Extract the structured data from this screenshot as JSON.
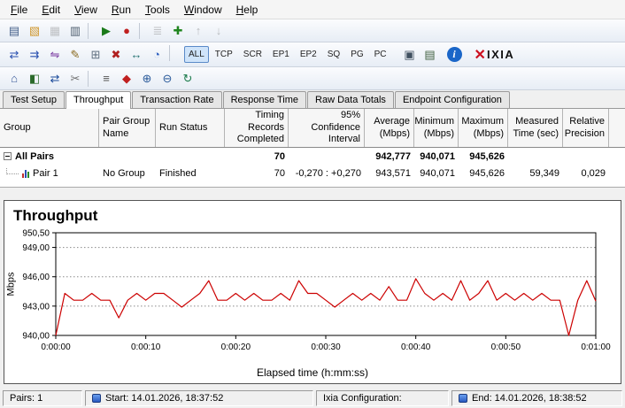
{
  "menu": {
    "items": [
      {
        "label": "File"
      },
      {
        "label": "Edit"
      },
      {
        "label": "View"
      },
      {
        "label": "Run"
      },
      {
        "label": "Tools"
      },
      {
        "label": "Window"
      },
      {
        "label": "Help"
      }
    ]
  },
  "toolbar_row1": {
    "icons": [
      {
        "name": "new-test-icon",
        "glyph": "▤",
        "color": "#44608a"
      },
      {
        "name": "open-test-icon",
        "glyph": "▧",
        "color": "#d09830"
      },
      {
        "name": "save-test-icon",
        "glyph": "▦",
        "color": "#607090",
        "disabled": true
      },
      {
        "name": "print-icon",
        "glyph": "▥",
        "color": "#506070"
      },
      {
        "sep": true
      },
      {
        "name": "run-test-icon",
        "glyph": "▶",
        "color": "#1a7a1a"
      },
      {
        "name": "abort-test-icon",
        "glyph": "●",
        "color": "#c02020"
      },
      {
        "sep": true
      },
      {
        "name": "view-results-icon",
        "glyph": "≣",
        "color": "#707070",
        "disabled": true
      },
      {
        "name": "add-item-icon",
        "glyph": "✚",
        "color": "#20851f"
      },
      {
        "name": "move-up-icon",
        "glyph": "↑",
        "color": "#606060",
        "disabled": true
      },
      {
        "name": "move-down-icon",
        "glyph": "↓",
        "color": "#606060",
        "disabled": true
      }
    ]
  },
  "toolbar_row2": {
    "icons_left": [
      {
        "name": "add-endpoint-pair-icon",
        "glyph": "⇄",
        "color": "#2a50b0"
      },
      {
        "name": "add-multicast-group-icon",
        "glyph": "⇉",
        "color": "#2a50b0"
      },
      {
        "name": "add-vpn-pair-icon",
        "glyph": "⇋",
        "color": "#7a3aa0"
      },
      {
        "name": "edit-pair-icon",
        "glyph": "✎",
        "color": "#8a6a20"
      },
      {
        "name": "copy-pair-icon",
        "glyph": "⊞",
        "color": "#607080"
      },
      {
        "name": "delete-pair-icon",
        "glyph": "✖",
        "color": "#b02020"
      },
      {
        "name": "connect-endpoints-icon",
        "glyph": "↔",
        "color": "#207070"
      },
      {
        "name": "schedule-icon",
        "glyph": "◔",
        "color": "#3060c0"
      },
      {
        "sep": true
      }
    ],
    "view_buttons": [
      {
        "name": "view-all-button",
        "label": "ALL",
        "active": true
      },
      {
        "name": "view-tcp-button",
        "label": "TCP"
      },
      {
        "name": "view-scr-button",
        "label": "SCR"
      },
      {
        "name": "view-ep1-button",
        "label": "EP1"
      },
      {
        "name": "view-ep2-button",
        "label": "EP2"
      },
      {
        "name": "view-sq-button",
        "label": "SQ"
      },
      {
        "name": "view-pg-button",
        "label": "PG"
      },
      {
        "name": "view-pc-button",
        "label": "PC"
      }
    ],
    "icons_right": [
      {
        "name": "snapshot-icon",
        "glyph": "▣",
        "color": "#405060"
      },
      {
        "name": "report-icon",
        "glyph": "▤",
        "color": "#406040"
      }
    ],
    "info_label": "i",
    "logo_mark": "✕",
    "logo_text": "IXIA"
  },
  "toolbar_row3": {
    "icons": [
      {
        "name": "add-console-icon",
        "glyph": "⌂",
        "color": "#3a5a9a"
      },
      {
        "name": "add-endpoint-icon",
        "glyph": "◧",
        "color": "#2a6a2a"
      },
      {
        "name": "link-endpoints-icon",
        "glyph": "⇄",
        "color": "#1a4a9a"
      },
      {
        "name": "cut-pair-icon",
        "glyph": "✂",
        "color": "#707070"
      },
      {
        "sep": true
      },
      {
        "name": "pair-properties-icon",
        "glyph": "≡",
        "color": "#555555"
      },
      {
        "name": "color-legend-icon",
        "glyph": "◆",
        "color": "#c02020"
      },
      {
        "name": "zoom-in-icon",
        "glyph": "⊕",
        "color": "#2a5a9a"
      },
      {
        "name": "zoom-out-icon",
        "glyph": "⊖",
        "color": "#2a5a9a"
      },
      {
        "name": "refresh-icon",
        "glyph": "↻",
        "color": "#1a7a4a"
      }
    ]
  },
  "tabs": [
    {
      "label": "Test Setup"
    },
    {
      "label": "Throughput",
      "active": true
    },
    {
      "label": "Transaction Rate"
    },
    {
      "label": "Response Time"
    },
    {
      "label": "Raw Data Totals"
    },
    {
      "label": "Endpoint Configuration"
    }
  ],
  "results_table": {
    "headers": [
      {
        "label": "Group"
      },
      {
        "label": "Pair Group\nName"
      },
      {
        "label": "Run Status"
      },
      {
        "label": "Timing Records\nCompleted",
        "cls": "right"
      },
      {
        "label": "95% Confidence\nInterval",
        "cls": "right"
      },
      {
        "label": "Average\n(Mbps)",
        "cls": "right"
      },
      {
        "label": "Minimum\n(Mbps)",
        "cls": "right"
      },
      {
        "label": "Maximum\n(Mbps)",
        "cls": "right"
      },
      {
        "label": "Measured\nTime (sec)",
        "cls": "right"
      },
      {
        "label": "Relative\nPrecision",
        "cls": "right"
      }
    ],
    "rows": {
      "all_pairs": {
        "group": "All Pairs",
        "timing_records": "70",
        "average": "942,777",
        "minimum": "940,071",
        "maximum": "945,626"
      },
      "pair1": {
        "group": "Pair 1",
        "pair_group": "No Group",
        "run_status": "Finished",
        "timing_records": "70",
        "confidence_interval": "-0,270 : +0,270",
        "average": "943,571",
        "minimum": "940,071",
        "maximum": "945,626",
        "measured_time": "59,349",
        "relative_precision": "0,029"
      }
    }
  },
  "chart_data": {
    "type": "line",
    "title": "Throughput",
    "ylabel": "Mbps",
    "xlabel": "Elapsed time (h:mm:ss)",
    "legend": "none",
    "grid": "horizontal-dotted",
    "line_color": "#cc0000",
    "ylim": [
      940,
      950.5
    ],
    "xlim": [
      0,
      60
    ],
    "yticks": [
      {
        "value": 940,
        "label": "940,00"
      },
      {
        "value": 943,
        "label": "943,00"
      },
      {
        "value": 946,
        "label": "946,00"
      },
      {
        "value": 949,
        "label": "949,00"
      },
      {
        "value": 950.5,
        "label": "950,50"
      }
    ],
    "xticks": [
      {
        "value": 0,
        "label": "0:00:00"
      },
      {
        "value": 10,
        "label": "0:00:10"
      },
      {
        "value": 20,
        "label": "0:00:20"
      },
      {
        "value": 30,
        "label": "0:00:30"
      },
      {
        "value": 40,
        "label": "0:00:40"
      },
      {
        "value": 50,
        "label": "0:00:50"
      },
      {
        "value": 60,
        "label": "0:01:00"
      }
    ],
    "x": [
      0,
      1,
      2,
      3,
      4,
      5,
      6,
      7,
      8,
      9,
      10,
      11,
      12,
      13,
      14,
      15,
      16,
      17,
      18,
      19,
      20,
      21,
      22,
      23,
      24,
      25,
      26,
      27,
      28,
      29,
      30,
      31,
      32,
      33,
      34,
      35,
      36,
      37,
      38,
      39,
      40,
      41,
      42,
      43,
      44,
      45,
      46,
      47,
      48,
      49,
      50,
      51,
      52,
      53,
      54,
      55,
      56,
      57,
      58,
      59,
      60
    ],
    "values": [
      940.0,
      944.3,
      943.6,
      943.6,
      944.3,
      943.6,
      943.6,
      941.8,
      943.6,
      944.3,
      943.6,
      944.3,
      944.3,
      943.6,
      942.9,
      943.6,
      944.3,
      945.6,
      943.6,
      943.6,
      944.3,
      943.6,
      944.3,
      943.6,
      943.6,
      944.3,
      943.6,
      945.6,
      944.3,
      944.3,
      943.6,
      942.9,
      943.6,
      944.3,
      943.6,
      944.3,
      943.6,
      945.0,
      943.6,
      943.6,
      945.8,
      944.3,
      943.6,
      944.3,
      943.6,
      945.6,
      943.6,
      944.3,
      945.6,
      943.6,
      944.3,
      943.6,
      944.3,
      943.6,
      944.3,
      943.6,
      943.6,
      940.0,
      943.6,
      945.6,
      943.5
    ]
  },
  "status_bar": {
    "pairs": "Pairs: 1",
    "start": "Start: 14.01.2026, 18:37:52",
    "config": "Ixia Configuration:",
    "end": "End: 14.01.2026, 18:38:52"
  }
}
